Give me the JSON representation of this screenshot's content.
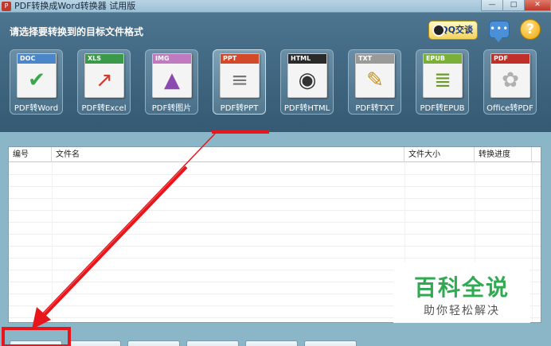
{
  "window": {
    "title": "PDF转换成Word转换器 试用版",
    "min_glyph": "—",
    "max_glyph": "□",
    "close_glyph": "✕"
  },
  "header": {
    "prompt": "请选择要转换到的目标文件格式",
    "qq_label": "QQ交谈",
    "chat_glyph": "•••",
    "help_glyph": "?"
  },
  "tools": [
    {
      "tag": "DOC",
      "label": "PDF转Word",
      "glyph": "✔",
      "tag_color": "#4a86c8",
      "glyph_color": "#3aa84a",
      "selected": false
    },
    {
      "tag": "XLS",
      "label": "PDF转Excel",
      "glyph": "↗",
      "tag_color": "#3a9a4a",
      "glyph_color": "#d03a2a",
      "selected": false
    },
    {
      "tag": "IMG",
      "label": "PDF转图片",
      "glyph": "▲",
      "tag_color": "#c07ac0",
      "glyph_color": "#8a4ab0",
      "selected": false
    },
    {
      "tag": "PPT",
      "label": "PDF转PPT",
      "glyph": "≡",
      "tag_color": "#d24a2a",
      "glyph_color": "#777777",
      "selected": true
    },
    {
      "tag": "HTML",
      "label": "PDF转HTML",
      "glyph": "◉",
      "tag_color": "#2a2a2a",
      "glyph_color": "#333333",
      "selected": false
    },
    {
      "tag": "TXT",
      "label": "PDF转TXT",
      "glyph": "✎",
      "tag_color": "#9a9a9a",
      "glyph_color": "#c09020",
      "selected": false
    },
    {
      "tag": "EPUB",
      "label": "PDF转EPUB",
      "glyph": "≣",
      "tag_color": "#7ab03a",
      "glyph_color": "#6a9a2a",
      "selected": false
    },
    {
      "tag": "PDF",
      "label": "Office转PDF",
      "glyph": "✿",
      "tag_color": "#c0302a",
      "glyph_color": "#b0b0b0",
      "selected": false
    }
  ],
  "table": {
    "columns": [
      "编号",
      "文件名",
      "文件大小",
      "转换进度"
    ]
  },
  "watermark": {
    "title": "百科全说",
    "subtitle": "助你轻松解决"
  }
}
